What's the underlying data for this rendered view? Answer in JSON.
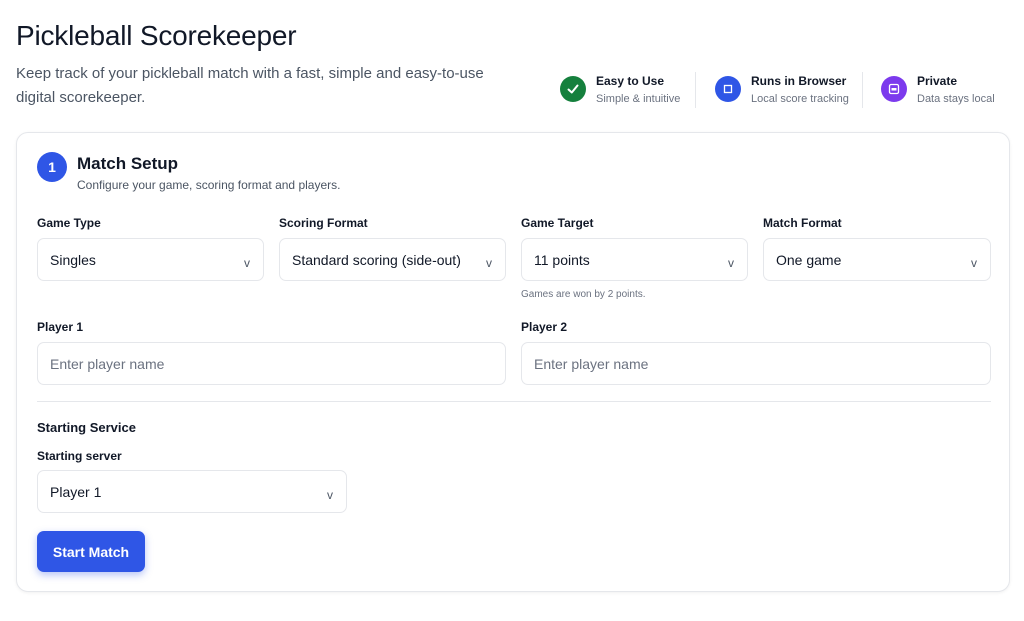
{
  "header": {
    "title": "Pickleball Scorekeeper",
    "subtitle": "Keep track of your pickleball match with a fast, simple and easy-to-use digital scorekeeper."
  },
  "features": [
    {
      "title": "Easy to Use",
      "subtitle": "Simple & intuitive",
      "icon": "check-icon",
      "color": "#15803d"
    },
    {
      "title": "Runs in Browser",
      "subtitle": "Local score tracking",
      "icon": "browser-icon",
      "color": "#2f56e6"
    },
    {
      "title": "Private",
      "subtitle": "Data stays local",
      "icon": "lock-icon",
      "color": "#7c3aed"
    }
  ],
  "setup": {
    "step": "1",
    "title": "Match Setup",
    "subtitle": "Configure your game, scoring format and players.",
    "game_type": {
      "label": "Game Type",
      "value": "Singles"
    },
    "scoring_format": {
      "label": "Scoring Format",
      "value": "Standard scoring (side-out)"
    },
    "game_target": {
      "label": "Game Target",
      "value": "11 points",
      "hint": "Games are won by 2 points."
    },
    "match_format": {
      "label": "Match Format",
      "value": "One game"
    },
    "player1": {
      "label": "Player 1",
      "placeholder": "Enter player name",
      "value": ""
    },
    "player2": {
      "label": "Player 2",
      "placeholder": "Enter player name",
      "value": ""
    },
    "service": {
      "section_title": "Starting Service",
      "server_label": "Starting server",
      "server_value": "Player 1"
    },
    "start_button": "Start Match"
  },
  "colors": {
    "accent": "#2f56e6",
    "success": "#15803d",
    "purple": "#7c3aed"
  },
  "chevron": "v"
}
